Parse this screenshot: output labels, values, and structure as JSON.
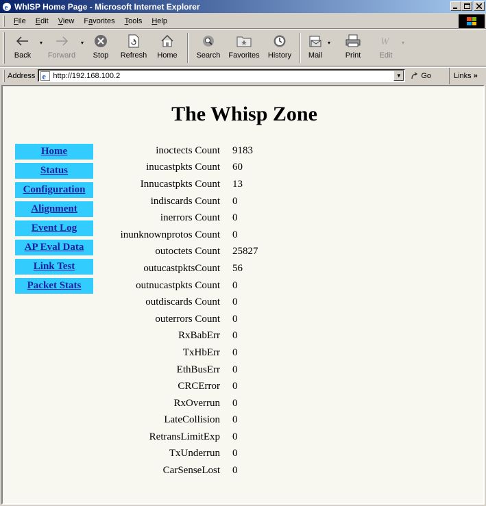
{
  "window": {
    "title": "WhISP Home Page - Microsoft Internet Explorer"
  },
  "menu": {
    "items": [
      {
        "underline": "F",
        "rest": "ile"
      },
      {
        "underline": "E",
        "rest": "dit"
      },
      {
        "underline": "V",
        "rest": "iew"
      },
      {
        "pre": "F",
        "underline": "a",
        "rest": "vorites"
      },
      {
        "underline": "T",
        "rest": "ools"
      },
      {
        "underline": "H",
        "rest": "elp"
      }
    ]
  },
  "toolbar": {
    "back": "Back",
    "forward": "Forward",
    "stop": "Stop",
    "refresh": "Refresh",
    "home": "Home",
    "search": "Search",
    "favorites": "Favorites",
    "history": "History",
    "mail": "Mail",
    "print": "Print",
    "edit": "Edit"
  },
  "address": {
    "label": "Address",
    "url": "http://192.168.100.2",
    "go": "Go",
    "links": "Links"
  },
  "page": {
    "title": "The Whisp Zone",
    "nav": [
      "Home",
      "Status",
      "Configuration",
      "Alignment",
      "Event Log",
      "AP Eval Data",
      "Link Test",
      "Packet Stats"
    ],
    "stats": [
      {
        "label": "inoctects Count",
        "value": "9183"
      },
      {
        "label": "inucastpkts Count",
        "value": "60"
      },
      {
        "label": "Innucastpkts Count",
        "value": "13"
      },
      {
        "label": "indiscards Count",
        "value": "0"
      },
      {
        "label": "inerrors Count",
        "value": "0"
      },
      {
        "label": "inunknownprotos Count",
        "value": "0"
      },
      {
        "label": "outoctets Count",
        "value": "25827"
      },
      {
        "label": "outucastpktsCount",
        "value": "56"
      },
      {
        "label": "outnucastpkts Count",
        "value": "0"
      },
      {
        "label": "outdiscards Count",
        "value": "0"
      },
      {
        "label": "outerrors Count",
        "value": "0"
      },
      {
        "label": "RxBabErr",
        "value": "0"
      },
      {
        "label": "TxHbErr",
        "value": "0"
      },
      {
        "label": "EthBusErr",
        "value": "0"
      },
      {
        "label": "CRCError",
        "value": "0"
      },
      {
        "label": "RxOverrun",
        "value": "0"
      },
      {
        "label": "LateCollision",
        "value": "0"
      },
      {
        "label": "RetransLimitExp",
        "value": "0"
      },
      {
        "label": "TxUnderrun",
        "value": "0"
      },
      {
        "label": "CarSenseLost",
        "value": "0"
      }
    ]
  },
  "colors": {
    "nav_bg": "#33ccff",
    "nav_text": "#2020a0",
    "title_bar": "#0a246a",
    "page_bg": "#f8f8f0"
  }
}
